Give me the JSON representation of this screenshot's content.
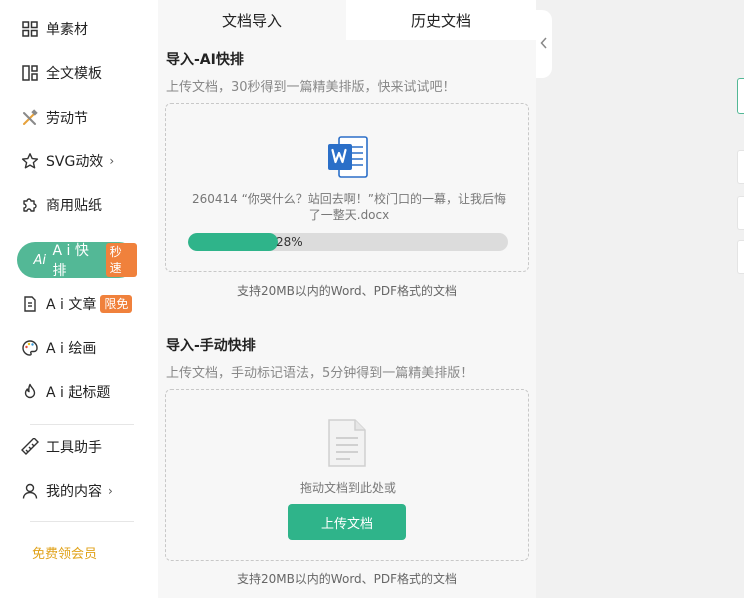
{
  "sidebar": {
    "items": [
      {
        "label": "单素材",
        "icon": "grid-icon"
      },
      {
        "label": "全文模板",
        "icon": "template-icon"
      },
      {
        "label": "劳动节",
        "icon": "tools-icon"
      },
      {
        "label": "SVG动效",
        "icon": "star-icon",
        "chevron": "›"
      },
      {
        "label": "商用贴纸",
        "icon": "puzzle-icon"
      },
      {
        "label": "A i 快排",
        "icon": "ai-icon",
        "badge": "秒速",
        "active": true
      },
      {
        "label": "A i 文章",
        "icon": "document-icon",
        "badge": "限免"
      },
      {
        "label": "A i 绘画",
        "icon": "palette-icon"
      },
      {
        "label": "A i 起标题",
        "icon": "flame-icon"
      },
      {
        "label": "工具助手",
        "icon": "ruler-icon"
      },
      {
        "label": "我的内容",
        "icon": "user-icon",
        "chevron": "›"
      }
    ],
    "vip_link": "免费领会员"
  },
  "tabs": {
    "import": "文档导入",
    "history": "历史文档"
  },
  "ai_import": {
    "title": "导入-AI快排",
    "desc": "上传文档，30秒得到一篇精美排版，快来试试吧！",
    "file_name": "260414 “你哭什么？站回去啊！”校门口的一幕，让我后悔了一整天.docx",
    "progress": 28,
    "progress_text": "28%",
    "hint": "支持20MB以内的Word、PDF格式的文档"
  },
  "manual_import": {
    "title": "导入-手动快排",
    "desc": "上传文档，手动标记语法，5分钟得到一篇精美排版！",
    "drag_text": "拖动文档到此处或",
    "upload_label": "上传文档",
    "hint": "支持20MB以内的Word、PDF格式的文档"
  },
  "colors": {
    "accent": "#2fb48a",
    "active_nav": "#53b896",
    "badge": "#f0813c",
    "vip": "#e0a21a",
    "word_blue": "#2b6fc8"
  }
}
